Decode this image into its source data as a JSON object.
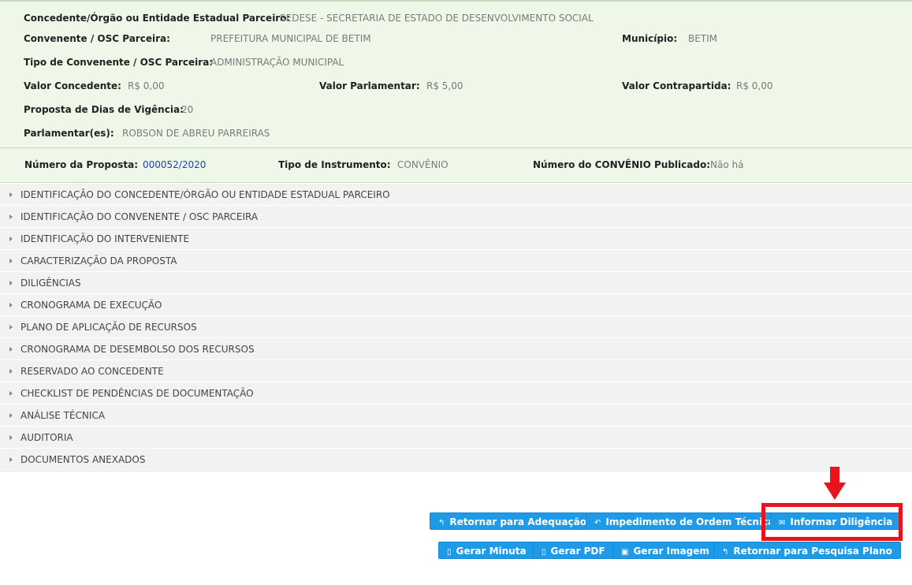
{
  "info": {
    "concedente_label": "Concedente/Órgão ou Entidade Estadual Parceiro:",
    "concedente_value": "SEDESE - SECRETARIA DE ESTADO DE DESENVOLVIMENTO SOCIAL",
    "convenente_label": "Convenente / OSC Parceira:",
    "convenente_value": "PREFEITURA MUNICIPAL DE BETIM",
    "municipio_label": "Município:",
    "municipio_value": "BETIM",
    "tipo_convenente_label": "Tipo de Convenente / OSC Parceira:",
    "tipo_convenente_value": "ADMINISTRAÇÃO MUNICIPAL",
    "valor_concedente_label": "Valor Concedente:",
    "valor_concedente_value": "R$ 0,00",
    "valor_parlamentar_label": "Valor Parlamentar:",
    "valor_parlamentar_value": "R$ 5,00",
    "valor_contrapartida_label": "Valor Contrapartida:",
    "valor_contrapartida_value": "R$ 0,00",
    "dias_vigencia_label": "Proposta de Dias de Vigência:",
    "dias_vigencia_value": "20",
    "parlamentar_label": "Parlamentar(es):",
    "parlamentar_value": "ROBSON DE ABREU PARREIRAS",
    "numero_proposta_label": "Número da Proposta:",
    "numero_proposta_value": "000052/2020",
    "tipo_instrumento_label": "Tipo de Instrumento:",
    "tipo_instrumento_value": "CONVÊNIO",
    "numero_convenio_label": "Número do CONVÊNIO Publicado:",
    "numero_convenio_value": "Não há"
  },
  "sections": [
    "IDENTIFICAÇÃO DO CONCEDENTE/ÓRGÃO OU ENTIDADE ESTADUAL PARCEIRO",
    "IDENTIFICAÇÃO DO CONVENENTE / OSC PARCEIRA",
    "IDENTIFICAÇÃO DO INTERVENIENTE",
    "CARACTERIZAÇÃO DA PROPOSTA",
    "DILIGÊNCIAS",
    "CRONOGRAMA DE EXECUÇÃO",
    "PLANO DE APLICAÇÃO DE RECURSOS",
    "CRONOGRAMA DE DESEMBOLSO DOS RECURSOS",
    "RESERVADO AO CONCEDENTE",
    "CHECKLIST DE PENDÊNCIAS DE DOCUMENTAÇÃO",
    "ANÁLISE TÉCNICA",
    "AUDITORIA",
    "DOCUMENTOS ANEXADOS"
  ],
  "buttons": {
    "retornar_adequacao": "Retornar para Adequação",
    "impedimento": "Impedimento de Ordem Técnica",
    "informar_diligencia": "Informar Diligência",
    "gerar_minuta": "Gerar Minuta",
    "gerar_pdf": "Gerar PDF",
    "gerar_imagem": "Gerar Imagem",
    "retornar_pesquisa": "Retornar para Pesquisa Plano"
  },
  "icons": {
    "reply": "reply-icon",
    "undo": "undo-icon",
    "mail": "envelope-icon",
    "file": "file-icon",
    "image": "image-icon",
    "arrow": "down-arrow-annotation"
  },
  "colors": {
    "panel_bg": "#eef7e8",
    "button": "#1e9be8",
    "highlight": "#e8141b",
    "link": "#2040c8"
  }
}
